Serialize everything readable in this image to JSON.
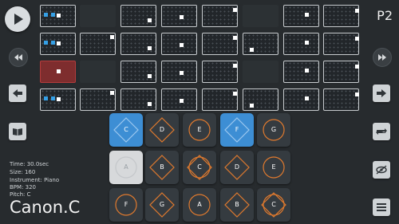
{
  "header": {
    "pattern_label": "P2"
  },
  "controls": {
    "left": [
      "play-icon",
      "rewind-icon",
      "arrow-left-icon",
      "book-icon"
    ],
    "right": [
      "fast-forward-icon",
      "arrow-right-icon",
      "repeat-icon",
      "eye-off-icon",
      "menu-icon"
    ]
  },
  "grid": {
    "rows": [
      {
        "cells": [
          {
            "state": "on",
            "dots": [
              "blue",
              "blue",
              "white"
            ]
          },
          {
            "state": "off",
            "dots": []
          },
          {
            "state": "on",
            "dots": [
              "white"
            ]
          },
          {
            "state": "on",
            "dots": [
              "white"
            ]
          },
          {
            "state": "on",
            "dots": [
              "white"
            ]
          },
          {
            "state": "off",
            "dots": []
          },
          {
            "state": "on",
            "dots": [
              "white"
            ]
          },
          {
            "state": "on",
            "dots": [
              "white"
            ]
          }
        ]
      },
      {
        "cells": [
          {
            "state": "on",
            "dots": [
              "blue",
              "blue",
              "white"
            ]
          },
          {
            "state": "on",
            "dots": [
              "white"
            ]
          },
          {
            "state": "on",
            "dots": [
              "white"
            ]
          },
          {
            "state": "on",
            "dots": [
              "white"
            ]
          },
          {
            "state": "on",
            "dots": [
              "white"
            ]
          },
          {
            "state": "on",
            "dots": [
              "white"
            ]
          },
          {
            "state": "on",
            "dots": [
              "white"
            ]
          },
          {
            "state": "on",
            "dots": [
              "white"
            ]
          }
        ]
      },
      {
        "cells": [
          {
            "state": "selected",
            "dots": [
              "white"
            ]
          },
          {
            "state": "off",
            "dots": []
          },
          {
            "state": "on",
            "dots": [
              "white"
            ]
          },
          {
            "state": "on",
            "dots": [
              "white"
            ]
          },
          {
            "state": "on",
            "dots": [
              "white"
            ]
          },
          {
            "state": "off",
            "dots": []
          },
          {
            "state": "on",
            "dots": [
              "white"
            ]
          },
          {
            "state": "on",
            "dots": [
              "white"
            ]
          }
        ]
      },
      {
        "cells": [
          {
            "state": "on",
            "dots": [
              "blue",
              "blue",
              "white"
            ]
          },
          {
            "state": "on",
            "dots": [
              "white"
            ]
          },
          {
            "state": "on",
            "dots": [
              "white"
            ]
          },
          {
            "state": "on",
            "dots": [
              "white"
            ]
          },
          {
            "state": "on",
            "dots": [
              "white"
            ]
          },
          {
            "state": "on",
            "dots": [
              "white"
            ]
          },
          {
            "state": "on",
            "dots": [
              "white"
            ]
          },
          {
            "state": "on",
            "dots": [
              "white"
            ]
          }
        ]
      }
    ]
  },
  "pads": [
    [
      {
        "note": "C",
        "shape": "diamond",
        "color": "blue"
      },
      {
        "note": "D",
        "shape": "diamond",
        "color": "dark"
      },
      {
        "note": "E",
        "shape": "circle",
        "color": "dark"
      },
      {
        "note": "F",
        "shape": "diamond",
        "color": "blue"
      },
      {
        "note": "G",
        "shape": "circle",
        "color": "dark"
      }
    ],
    [
      {
        "note": "A",
        "shape": "circle",
        "color": "white"
      },
      {
        "note": "B",
        "shape": "diamond",
        "color": "dark"
      },
      {
        "note": "C",
        "shape": "both",
        "color": "dark"
      },
      {
        "note": "D",
        "shape": "diamond",
        "color": "dark"
      },
      {
        "note": "E",
        "shape": "circle",
        "color": "dark"
      }
    ],
    [
      {
        "note": "F",
        "shape": "circle",
        "color": "dark"
      },
      {
        "note": "G",
        "shape": "diamond",
        "color": "dark"
      },
      {
        "note": "A",
        "shape": "circle",
        "color": "dark"
      },
      {
        "note": "B",
        "shape": "diamond",
        "color": "dark"
      },
      {
        "note": "C",
        "shape": "both",
        "color": "dark"
      }
    ]
  ],
  "info": {
    "time": "Time: 30.0sec",
    "size": "Size: 160",
    "instrument": "Instrument: Piano",
    "bpm": "BPM: 320",
    "pitch": "Pitch: C"
  },
  "song_title": "Canon.C",
  "colors": {
    "blue": "#3d8ed4",
    "orange": "#e07a2e",
    "selected_red": "#7e2d2e",
    "background": "#272b2e"
  }
}
